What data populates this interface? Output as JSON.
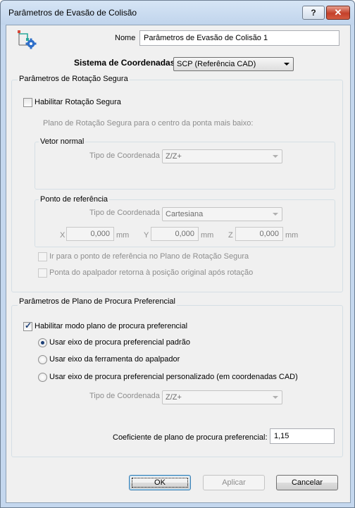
{
  "window": {
    "title": "Parâmetros de Evasão de Colisão",
    "help_button": "?",
    "close_button": "✕"
  },
  "name_field": {
    "label": "Nome",
    "value": "Parâmetros de Evasão de Colisão 1"
  },
  "coordinate_system": {
    "label": "Sistema de Coordenadas",
    "value": "SCP (Referência CAD)"
  },
  "safe_rotation": {
    "group_title": "Parâmetros de Rotação Segura",
    "enable_label": "Habilitar Rotação Segura",
    "enabled": false,
    "plane_text": "Plano de Rotação Segura para o centro da ponta mais baixo:",
    "normal_vector": {
      "group_title": "Vetor normal",
      "coord_type_label": "Tipo de Coordenada",
      "coord_type_value": "Z/Z+"
    },
    "reference_point": {
      "group_title": "Ponto de referência",
      "coord_type_label": "Tipo de Coordenada",
      "coord_type_value": "Cartesiana",
      "x_label": "X",
      "x_value": "0,000",
      "y_label": "Y",
      "y_value": "0,000",
      "z_label": "Z",
      "z_value": "0,000",
      "unit": "mm"
    },
    "goto_reference_label": "Ir para o ponto de referência no Plano de Rotação Segura",
    "return_original_label": "Ponta do apalpador retorna à posição original após rotação"
  },
  "preferred_plane": {
    "group_title": "Parâmetros de Plano de Procura Preferencial",
    "enable_label": "Habilitar modo plano de procura preferencial",
    "enabled": true,
    "options": [
      "Usar eixo de procura preferencial padrão",
      "Usar eixo da ferramenta do apalpador",
      "Usar eixo de procura preferencial personalizado (em coordenadas CAD)"
    ],
    "selected_index": 0,
    "coord_type_label": "Tipo de Coordenada",
    "coord_type_value": "Z/Z+",
    "coefficient_label": "Coeficiente de plano de procura preferencial:",
    "coefficient_value": "1,15"
  },
  "buttons": {
    "ok": "OK",
    "apply": "Aplicar",
    "cancel": "Cancelar"
  },
  "colors": {
    "accent": "#1c3f76",
    "disabled_text": "#8d8d8d",
    "icon_blue": "#2f6fc9",
    "icon_teal": "#2aa79b"
  },
  "icons": {
    "dialog": "axes-gear-icon"
  }
}
